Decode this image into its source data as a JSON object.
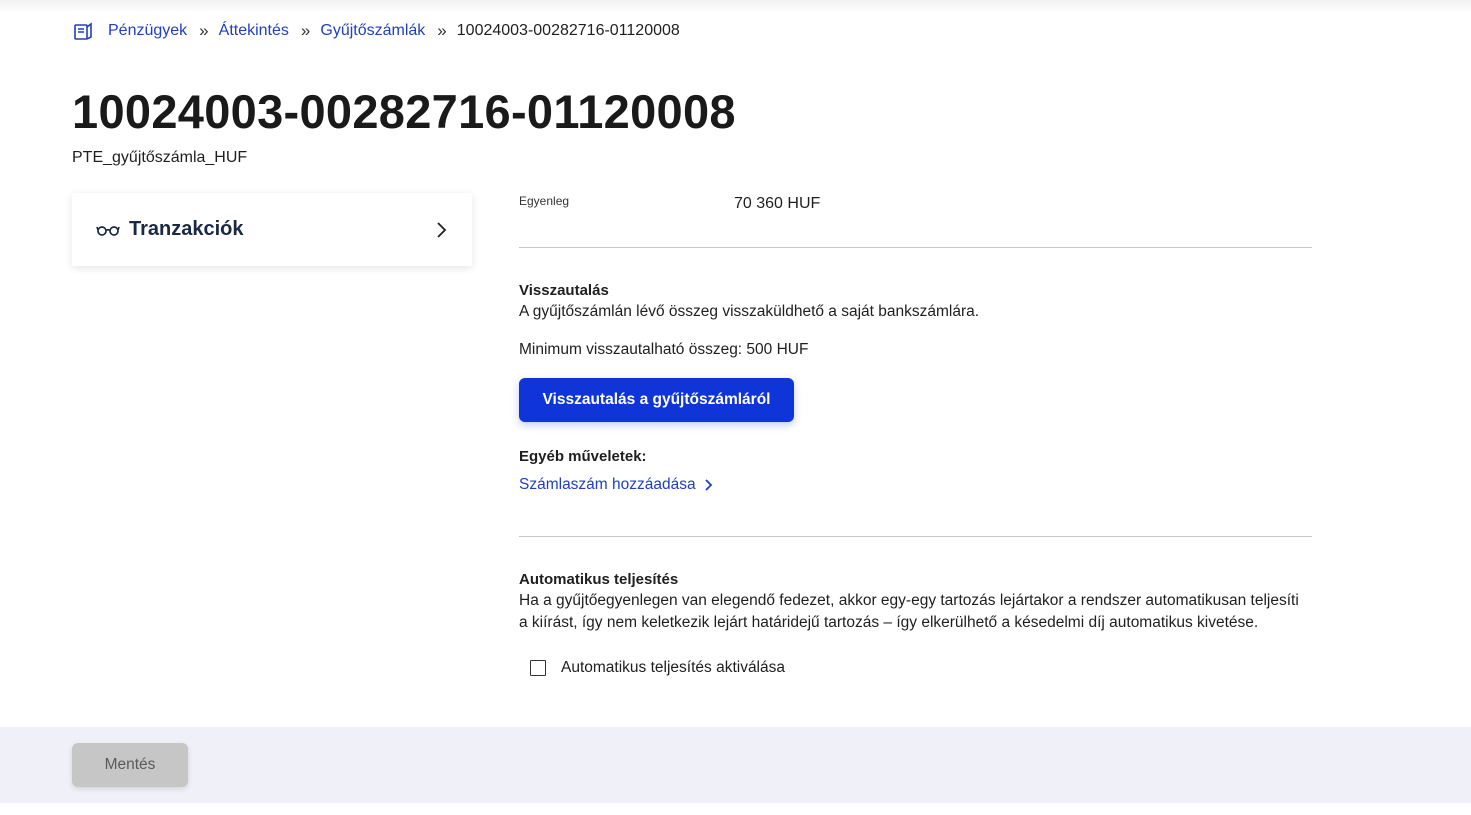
{
  "breadcrumb": {
    "items": [
      "Pénzügyek",
      "Áttekintés",
      "Gyűjtőszámlák"
    ],
    "separator": "»",
    "current": "10024003-00282716-01120008"
  },
  "header": {
    "title": "10024003-00282716-01120008",
    "subtitle": "PTE_gyűjtőszámla_HUF"
  },
  "sidebar": {
    "card_label": "Tranzakciók"
  },
  "balance": {
    "label": "Egyenleg",
    "value": "70 360 HUF"
  },
  "refund": {
    "title": "Visszautalás",
    "description": "A gyűjtőszámlán lévő összeg visszaküldhető a saját bankszámlára.",
    "minimum": "Minimum visszautalható összeg: 500 HUF",
    "button_label": "Visszautalás a gyűjtőszámláról"
  },
  "other_actions": {
    "title": "Egyéb műveletek:",
    "link_label": "Számlaszám hozzáadása"
  },
  "auto_payment": {
    "title": "Automatikus teljesítés",
    "description_line1": "Ha a gyűjtőegyenlegen van elegendő fedezet, akkor egy-egy tartozás lejártakor a rendszer automatikusan teljesíti",
    "description_line2": "a kiírást, így nem keletkezik lejárt határidejű tartozás – így elkerülhető a késedelmi díj automatikus kivetése.",
    "checkbox_label": "Automatikus teljesítés aktiválása",
    "checked": false
  },
  "footer": {
    "save_label": "Mentés"
  },
  "colors": {
    "primary": "#0f35d9",
    "link": "#1f3fbf",
    "footer_bg": "#f0f1f8",
    "disabled_button": "#c6c6c6"
  },
  "icons": {
    "home": "finance-book-icon",
    "transactions": "glasses-icon",
    "card_chevron": "chevron-right-icon",
    "link_chevron": "chevron-right-icon"
  }
}
